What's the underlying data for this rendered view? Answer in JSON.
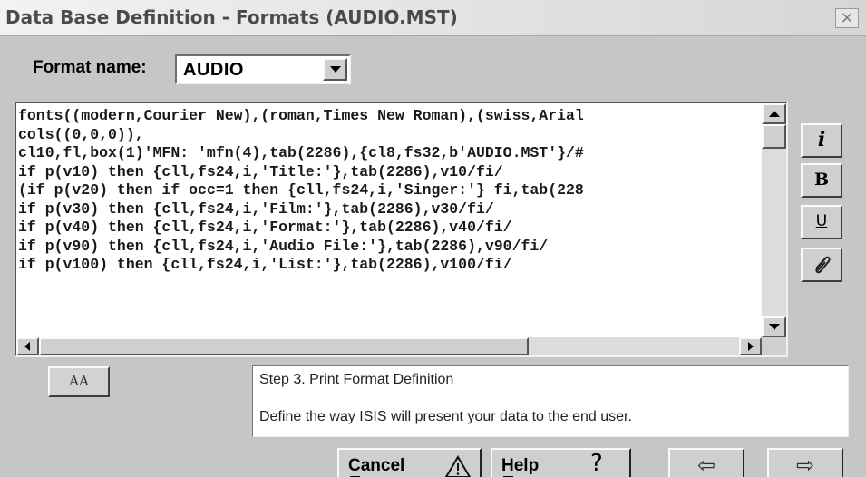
{
  "window": {
    "title": "Data Base Definition - Formats (AUDIO.MST)",
    "close_glyph": "×"
  },
  "format": {
    "label": "Format name:",
    "selected": "AUDIO"
  },
  "editor": {
    "lines": [
      "fonts((modern,Courier New),(roman,Times New Roman),(swiss,Arial",
      "cols((0,0,0)),",
      "cl10,fl,box(1)'MFN: 'mfn(4),tab(2286),{cl8,fs32,b'AUDIO.MST'}/#",
      "if p(v10) then {cll,fs24,i,'Title:'},tab(2286),v10/fi/",
      "(if p(v20) then if occ=1 then {cll,fs24,i,'Singer:'} fi,tab(228",
      "if p(v30) then {cll,fs24,i,'Film:'},tab(2286),v30/fi/",
      "if p(v40) then {cll,fs24,i,'Format:'},tab(2286),v40/fi/",
      "if p(v90) then {cll,fs24,i,'Audio File:'},tab(2286),v90/fi/",
      "if p(v100) then {cll,fs24,i,'List:'},tab(2286),v100/fi/"
    ]
  },
  "tools": {
    "italic": "i",
    "bold": "B",
    "underline": "U",
    "link_icon": "paperclip-icon"
  },
  "font_button": {
    "glyph": "AA",
    "icon": "font-icon"
  },
  "step": {
    "title": "Step 3. Print Format Definition",
    "description": "Define the way ISIS will present your data to the end user."
  },
  "buttons": {
    "cancel": "Cancel",
    "help": "Help",
    "help_glyph": "?",
    "back_glyph": "⇦",
    "next_glyph": "⇨"
  },
  "colors": {
    "dialog_bg": "#c6c6c6",
    "title_text": "#4a4a4a"
  }
}
